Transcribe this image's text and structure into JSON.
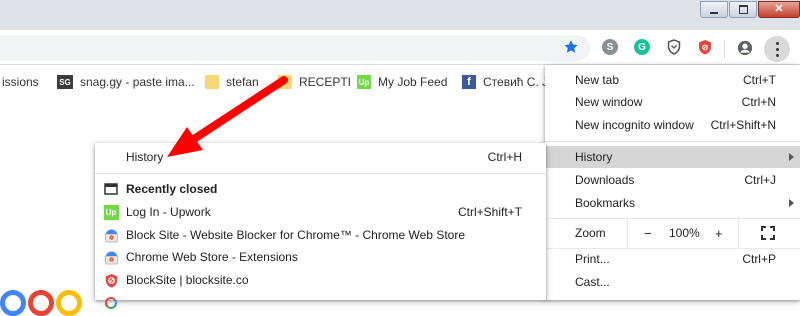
{
  "colors": {
    "accent_blue": "#1a73e8",
    "highlight": "#d5d5d5",
    "arrow_red": "#ff0000",
    "upwork_green": "#6fda44",
    "folder_yellow": "#f7d774"
  },
  "window_controls": [
    {
      "name": "minimize-button",
      "icon": "minimize-icon"
    },
    {
      "name": "restore-button",
      "icon": "restore-icon"
    },
    {
      "name": "close-window-button",
      "icon": "close-icon"
    }
  ],
  "toolbar": {
    "bookmark_star_icon": "star-icon",
    "extensions": [
      "skype-icon",
      "grammarly-icon",
      "shield-icon",
      "blocksite-icon"
    ],
    "profile_icon": "account-icon",
    "menu_icon": "kebab-menu-icon"
  },
  "bookmarks": [
    {
      "label": "issions",
      "icon": "none"
    },
    {
      "label": "snag.gy - paste ima...",
      "icon": "sg-icon"
    },
    {
      "label": "stefan",
      "icon": "folder-icon"
    },
    {
      "label": "RECEPTI",
      "icon": "folder-icon"
    },
    {
      "label": "My Job Feed",
      "icon": "upwork-icon"
    },
    {
      "label": "Стевић С. Ј",
      "icon": "facebook-icon"
    }
  ],
  "main_menu": {
    "new_tab": {
      "label": "New tab",
      "shortcut": "Ctrl+T"
    },
    "new_window": {
      "label": "New window",
      "shortcut": "Ctrl+N"
    },
    "new_incognito": {
      "label": "New incognito window",
      "shortcut": "Ctrl+Shift+N"
    },
    "history": {
      "label": "History"
    },
    "downloads": {
      "label": "Downloads",
      "shortcut": "Ctrl+J"
    },
    "bookmarks": {
      "label": "Bookmarks"
    },
    "zoom": {
      "label": "Zoom",
      "minus": "−",
      "value": "100%",
      "plus": "+"
    },
    "print": {
      "label": "Print...",
      "shortcut": "Ctrl+P"
    },
    "cast": {
      "label": "Cast..."
    }
  },
  "history_menu": {
    "history": {
      "label": "History",
      "shortcut": "Ctrl+H"
    },
    "recently_closed": {
      "label": "Recently closed"
    },
    "items": [
      {
        "label": "Log In - Upwork",
        "shortcut": "Ctrl+Shift+T",
        "icon": "upwork-icon"
      },
      {
        "label": "Block Site - Website Blocker for Chrome™ - Chrome Web Store",
        "shortcut": "",
        "icon": "chrome-web-store-icon"
      },
      {
        "label": "Chrome Web Store - Extensions",
        "shortcut": "",
        "icon": "chrome-web-store-icon"
      },
      {
        "label": "BlockSite | blocksite.co",
        "shortcut": "",
        "icon": "blocksite-icon"
      }
    ]
  }
}
